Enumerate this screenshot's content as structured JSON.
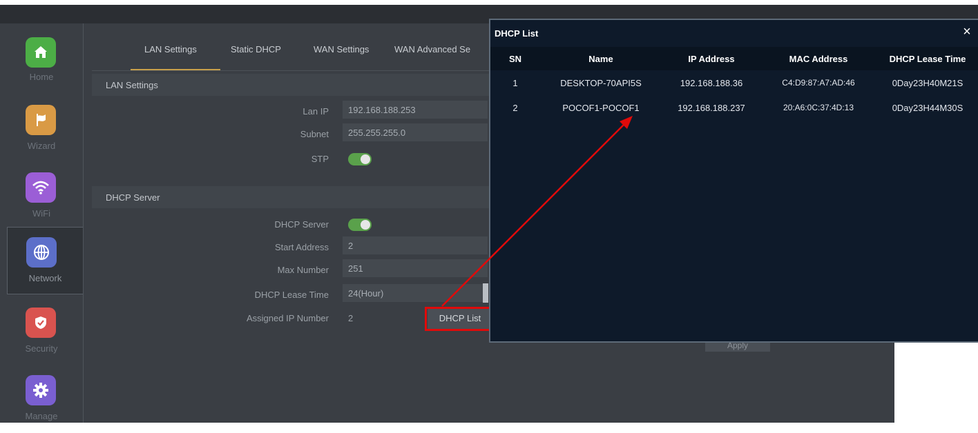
{
  "sidebar": {
    "items": [
      {
        "label": "Home",
        "icon": "home-icon",
        "color": "#4cae46"
      },
      {
        "label": "Wizard",
        "icon": "flag-icon",
        "color": "#d99a45"
      },
      {
        "label": "WiFi",
        "icon": "wifi-icon",
        "color": "#9b5ed6"
      },
      {
        "label": "Network",
        "icon": "globe-icon",
        "color": "#5c6fc9"
      },
      {
        "label": "Security",
        "icon": "shield-icon",
        "color": "#d9534f"
      },
      {
        "label": "Manage",
        "icon": "gear-icon",
        "color": "#7a5fd1"
      }
    ],
    "active": "Network"
  },
  "tabs": [
    "LAN Settings",
    "Static DHCP",
    "WAN Settings",
    "WAN Advanced Se"
  ],
  "active_tab": "LAN Settings",
  "lan": {
    "section_title": "LAN Settings",
    "lan_ip_label": "Lan IP",
    "lan_ip_value": "192.168.188.253",
    "subnet_label": "Subnet",
    "subnet_value": "255.255.255.0",
    "stp_label": "STP",
    "stp_on": true
  },
  "dhcp": {
    "section_title": "DHCP Server",
    "server_label": "DHCP Server",
    "server_on": true,
    "start_label": "Start Address",
    "start_value": "2",
    "max_label": "Max Number",
    "max_value": "251",
    "lease_label": "DHCP Lease Time",
    "lease_value": "24(Hour)",
    "assigned_label": "Assigned IP Number",
    "assigned_value": "2",
    "list_button": "DHCP List"
  },
  "apply_label": "Apply",
  "popup": {
    "title": "DHCP List",
    "close": "×",
    "columns": [
      "SN",
      "Name",
      "IP Address",
      "MAC Address",
      "DHCP Lease Time"
    ],
    "rows": [
      {
        "sn": "1",
        "name": "DESKTOP-70API5S",
        "ip": "192.168.188.36",
        "mac": "C4:D9:87:A7:AD:46",
        "lease": "0Day23H40M21S"
      },
      {
        "sn": "2",
        "name": "POCOF1-POCOF1",
        "ip": "192.168.188.237",
        "mac": "20:A6:0C:37:4D:13",
        "lease": "0Day23H44M30S"
      }
    ]
  },
  "colors": {
    "annotation": "#e10a0a",
    "toggle_on": "#5aa14b",
    "tab_accent": "#c9a04a"
  }
}
